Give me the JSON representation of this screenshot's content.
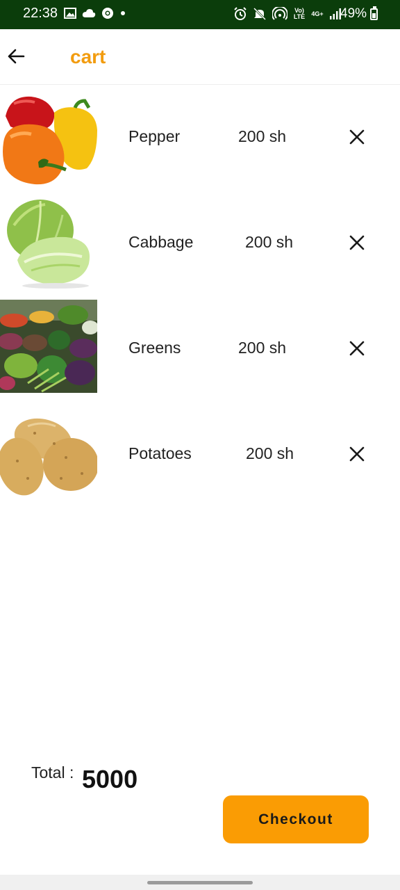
{
  "status_bar": {
    "time": "22:38",
    "battery": "49%",
    "left_icons": [
      "gallery-icon",
      "cloud-icon",
      "chrome-icon",
      "dot-icon"
    ],
    "right_icons": [
      "alarm-icon",
      "mute-icon",
      "hotspot-icon",
      "volte-icon",
      "4g-icon",
      "signal-icon",
      "battery-icon"
    ],
    "volte_text": "Vo) LTE",
    "net_text": "4G+"
  },
  "app_bar": {
    "title": "cart",
    "back_icon": "arrow-left-icon",
    "title_color": "#f29c0f"
  },
  "cart": {
    "items": [
      {
        "name": "Pepper",
        "price": "200 sh",
        "image": "peppers",
        "remove_icon": "close-icon"
      },
      {
        "name": "Cabbage",
        "price": "200 sh",
        "image": "cabbage",
        "remove_icon": "close-icon"
      },
      {
        "name": "Greens",
        "price": "200 sh",
        "image": "vegetable-market",
        "remove_icon": "close-icon"
      },
      {
        "name": "Potatoes",
        "price": "200 sh",
        "image": "potatoes",
        "remove_icon": "close-icon"
      }
    ]
  },
  "summary": {
    "total_label": "Total :",
    "total_value": "5000",
    "checkout_label": "Checkout",
    "checkout_color": "#fa9c04"
  }
}
